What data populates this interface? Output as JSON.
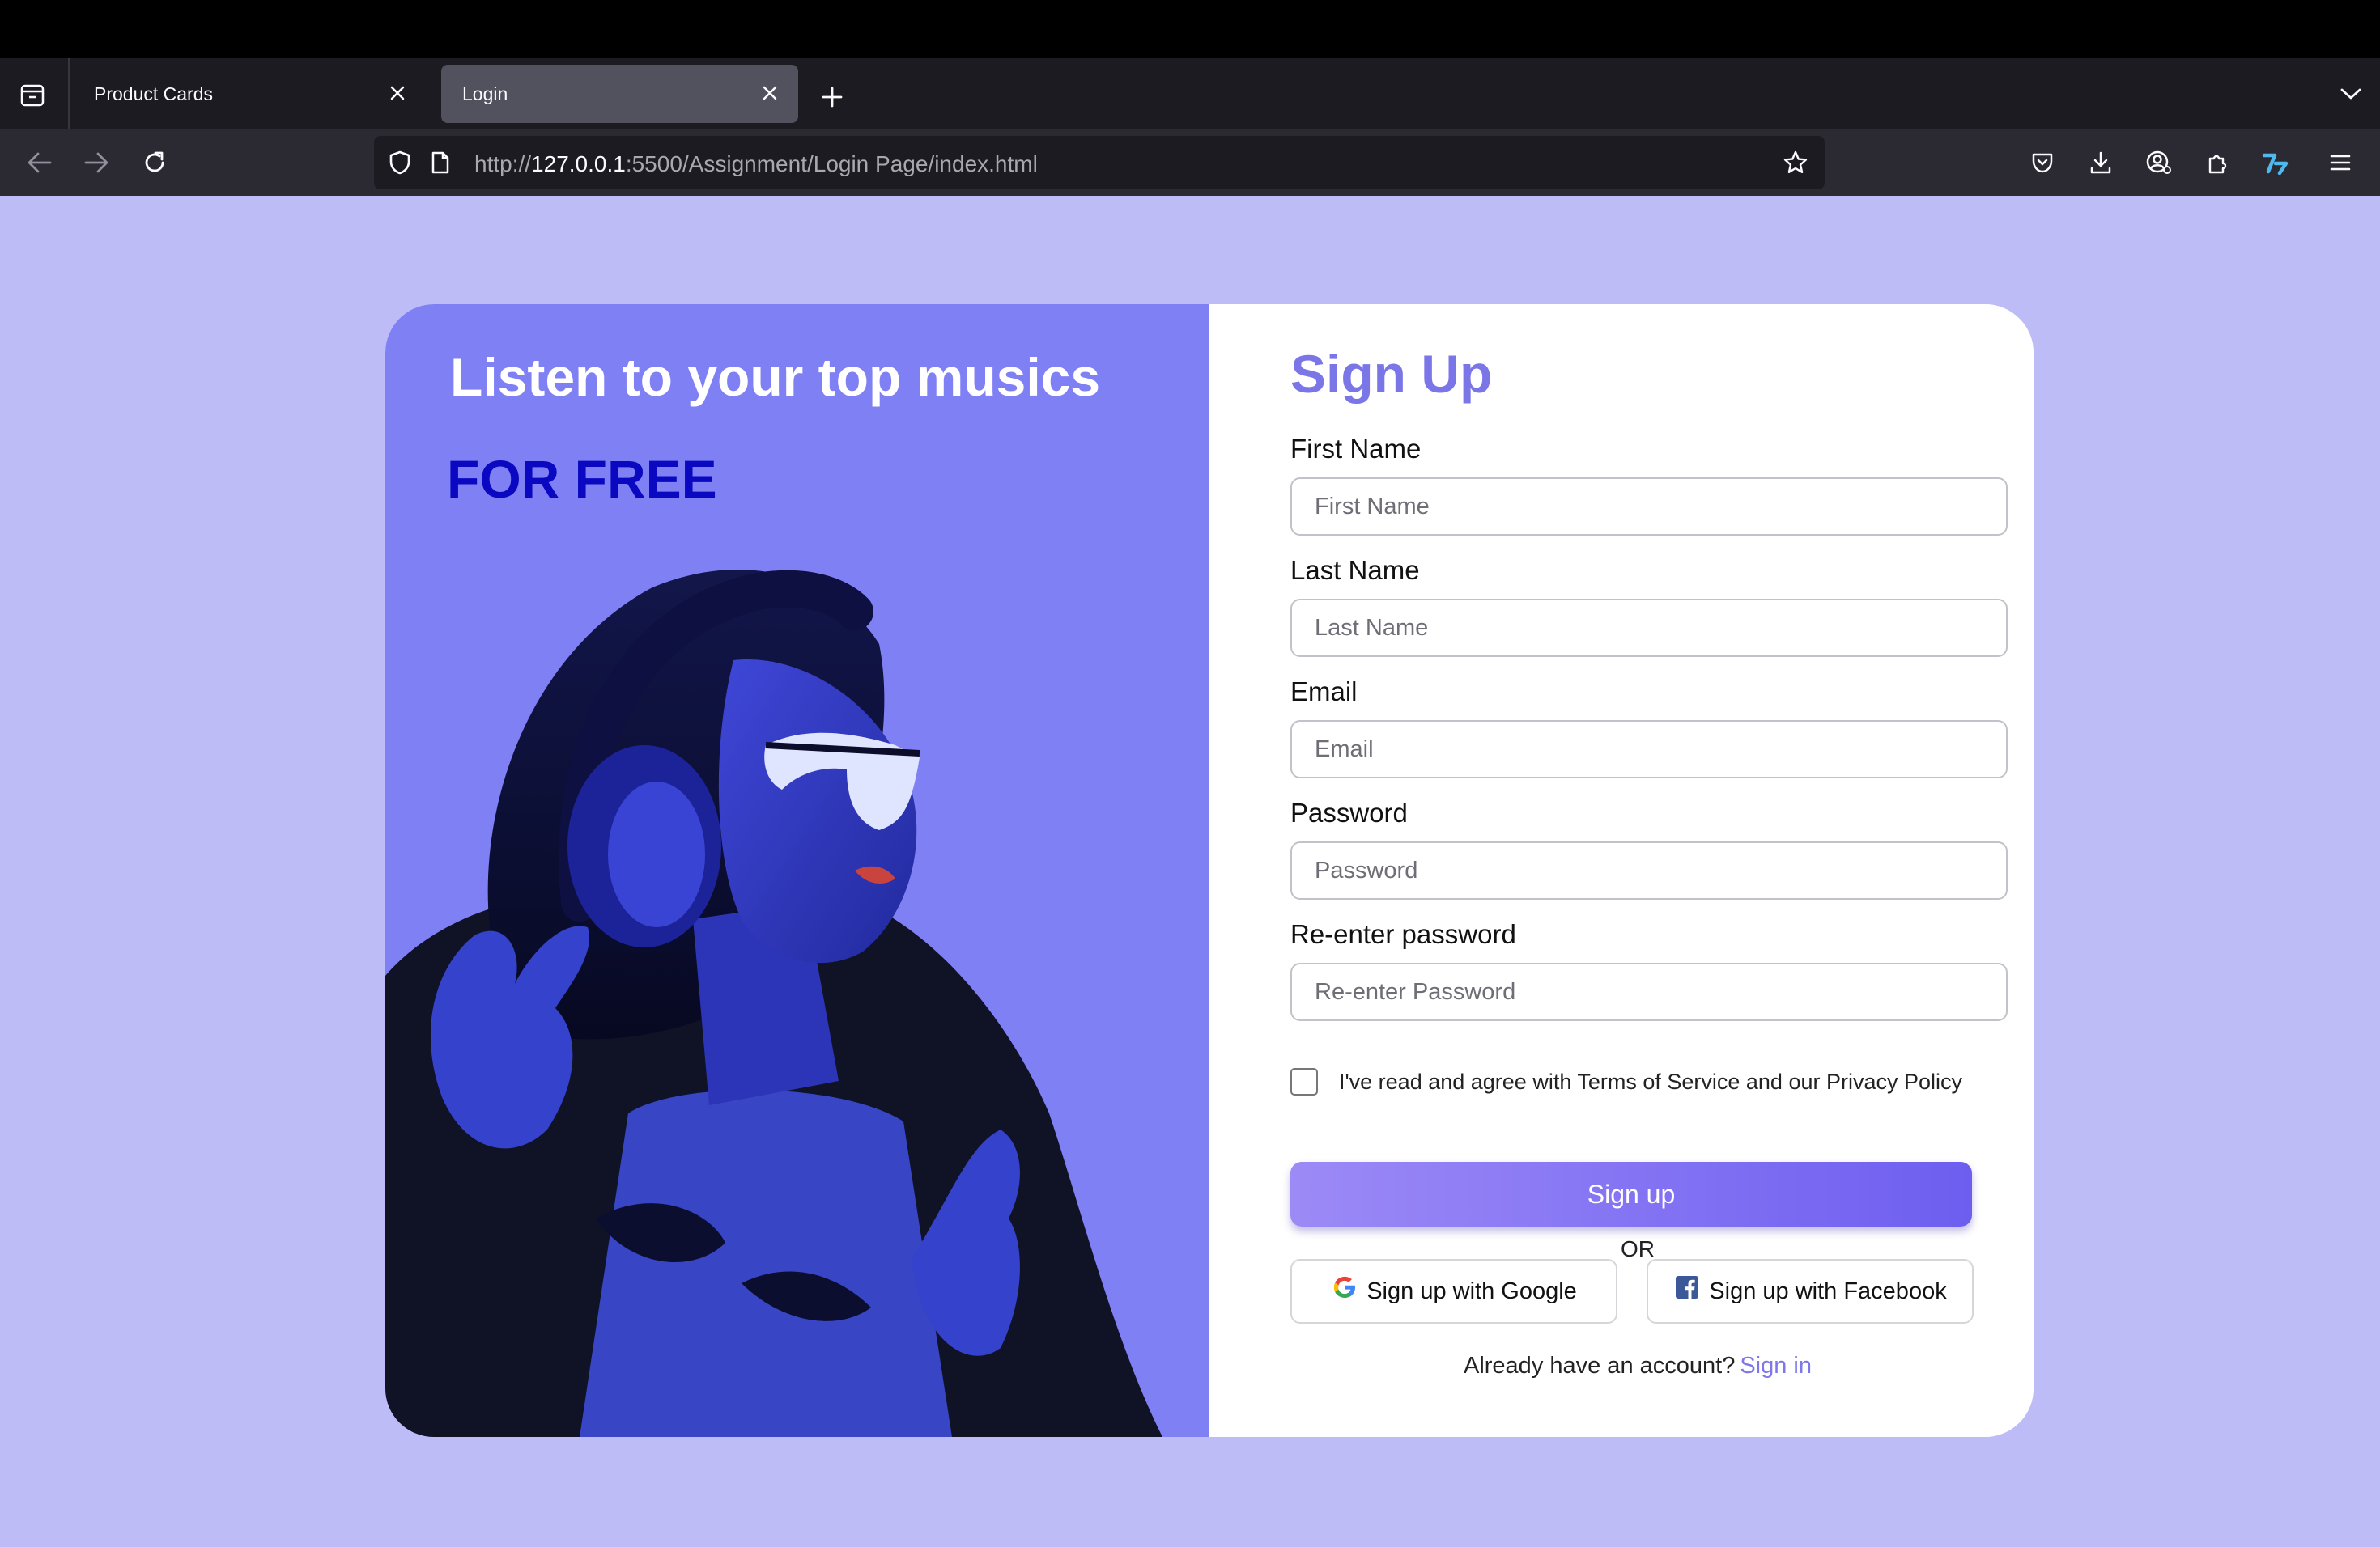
{
  "browser": {
    "tabs": [
      {
        "title": "Product Cards",
        "active": false
      },
      {
        "title": "Login",
        "active": true
      }
    ],
    "url": {
      "scheme": "http://",
      "host": "127.0.0.1",
      "rest": ":5500/Assignment/Login Page/index.html"
    },
    "icons": {
      "tab_overview": "tab-overview-icon",
      "back": "back-arrow-icon",
      "forward": "forward-arrow-icon",
      "reload": "reload-icon",
      "shield": "tracking-shield-icon",
      "page": "page-icon",
      "bookmark": "star-icon",
      "pocket": "pocket-icon",
      "downloads": "download-icon",
      "account": "account-icon",
      "extensions": "extensions-icon",
      "extension": "extension-logo-icon",
      "menu": "hamburger-menu-icon"
    }
  },
  "colors": {
    "page_bg": "#bebcf7",
    "hero_bg": "#8080f5",
    "accent": "#7b76e8",
    "hero_sub": "#0a08c0"
  },
  "hero": {
    "title": "Listen to your top musics",
    "subtitle": "FOR FREE"
  },
  "form": {
    "title": "Sign Up",
    "fields": [
      {
        "label": "First Name",
        "placeholder": "First Name",
        "value": ""
      },
      {
        "label": "Last Name",
        "placeholder": "Last Name",
        "value": ""
      },
      {
        "label": "Email",
        "placeholder": "Email",
        "value": ""
      },
      {
        "label": "Password",
        "placeholder": "Password",
        "value": ""
      },
      {
        "label": "Re-enter password",
        "placeholder": "Re-enter Password",
        "value": ""
      }
    ],
    "terms": "I've read and agree with Terms of Service and our Privacy Policy",
    "terms_checked": false,
    "submit": "Sign up",
    "or": "OR",
    "google": "Sign up with Google",
    "facebook": "Sign up with Facebook",
    "signin_prompt": "Already have an account?",
    "signin_link": "Sign in"
  }
}
